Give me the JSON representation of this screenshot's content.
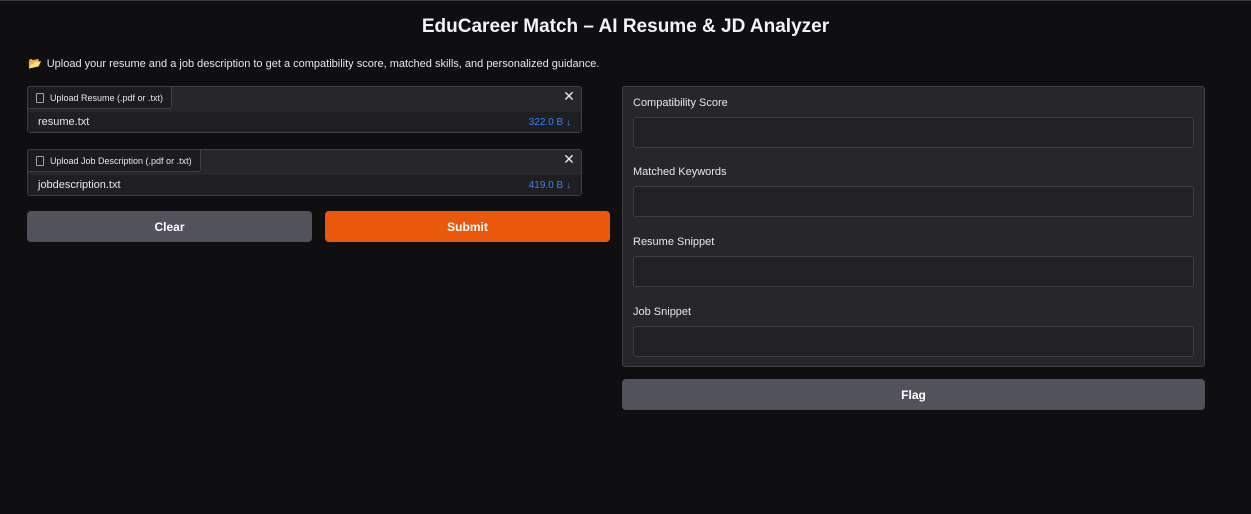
{
  "title": "EduCareer Match – AI Resume & JD Analyzer",
  "description": {
    "icon": "folder-icon",
    "text": "Upload your resume and a job description to get a compatibility score, matched skills, and personalized guidance."
  },
  "inputs": {
    "resume": {
      "label": "Upload Resume (.pdf or .txt)",
      "file_name": "resume.txt",
      "file_size": "322.0 B ↓"
    },
    "job_description": {
      "label": "Upload Job Description (.pdf or .txt)",
      "file_name": "jobdescription.txt",
      "file_size": "419.0 B ↓"
    }
  },
  "buttons": {
    "clear": "Clear",
    "submit": "Submit",
    "flag": "Flag"
  },
  "outputs": {
    "compatibility_score": {
      "label": "Compatibility Score",
      "value": ""
    },
    "matched_keywords": {
      "label": "Matched Keywords",
      "value": ""
    },
    "resume_snippet": {
      "label": "Resume Snippet",
      "value": ""
    },
    "job_snippet": {
      "label": "Job Snippet",
      "value": ""
    }
  },
  "colors": {
    "accent": "#ea580c",
    "link": "#3b82f6",
    "background": "#0f0f11"
  }
}
